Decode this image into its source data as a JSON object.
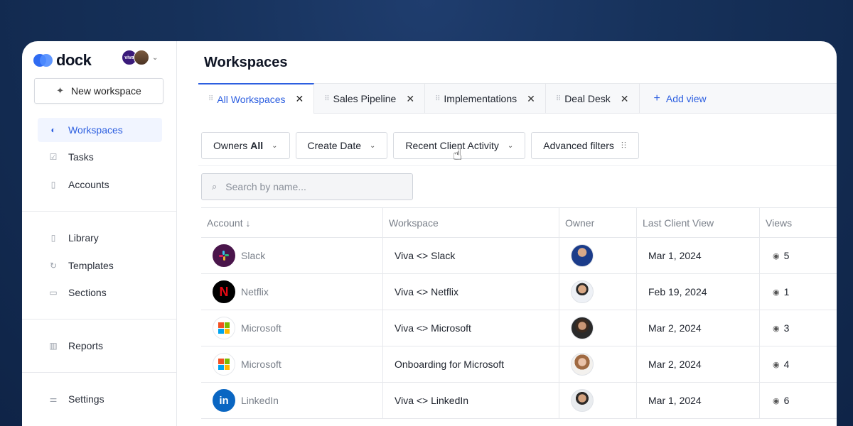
{
  "brand": {
    "name": "dock",
    "avatar_badge": "viva"
  },
  "sidebar": {
    "new_workspace": "New workspace",
    "items": [
      {
        "label": "Workspaces",
        "icon": "workspaces-icon",
        "active": true
      },
      {
        "label": "Tasks",
        "icon": "check-square-icon"
      },
      {
        "label": "Accounts",
        "icon": "accounts-icon"
      },
      {
        "label": "Library",
        "icon": "library-icon"
      },
      {
        "label": "Templates",
        "icon": "templates-icon"
      },
      {
        "label": "Sections",
        "icon": "sections-icon"
      },
      {
        "label": "Reports",
        "icon": "bar-chart-icon"
      },
      {
        "label": "Settings",
        "icon": "sliders-icon"
      }
    ]
  },
  "main": {
    "title": "Workspaces",
    "tabs": [
      {
        "label": "All Workspaces",
        "active": true
      },
      {
        "label": "Sales Pipeline"
      },
      {
        "label": "Implementations"
      },
      {
        "label": "Deal Desk"
      }
    ],
    "add_view": "Add view",
    "filters": {
      "owners_label": "Owners",
      "owners_value": "All",
      "create_date": "Create Date",
      "recent_activity": "Recent Client Activity",
      "advanced": "Advanced filters"
    },
    "search_placeholder": "Search by name...",
    "table": {
      "headers": {
        "account": "Account ↓",
        "workspace": "Workspace",
        "owner": "Owner",
        "last_view": "Last Client View",
        "views": "Views"
      },
      "rows": [
        {
          "account": "Slack",
          "workspace": "Viva <> Slack",
          "last_view": "Mar 1, 2024",
          "views": "5"
        },
        {
          "account": "Netflix",
          "workspace": "Viva <> Netflix",
          "last_view": "Feb 19, 2024",
          "views": "1"
        },
        {
          "account": "Microsoft",
          "workspace": "Viva <> Microsoft",
          "last_view": "Mar 2, 2024",
          "views": "3"
        },
        {
          "account": "Microsoft",
          "workspace": "Onboarding for Microsoft",
          "last_view": "Mar 2, 2024",
          "views": "4"
        },
        {
          "account": "LinkedIn",
          "workspace": "Viva <> LinkedIn",
          "last_view": "Mar 1, 2024",
          "views": "6"
        }
      ]
    }
  },
  "colors": {
    "accent": "#2d5fe0",
    "background": "#16315a"
  }
}
